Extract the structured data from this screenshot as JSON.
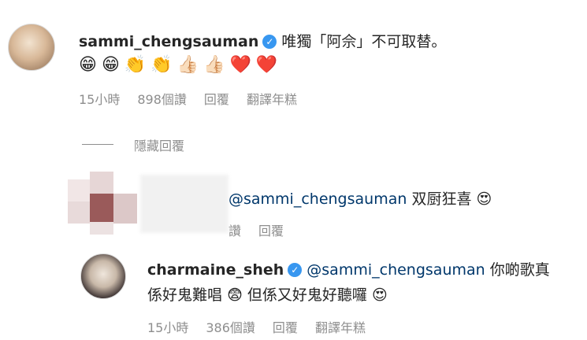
{
  "comments": [
    {
      "username": "sammi_chengsauman",
      "text": "唯獨「阿佘」不可取替。",
      "emojis": [
        "😁",
        "😁",
        "👏",
        "👏",
        "👍🏻",
        "👍🏻",
        "❤️",
        "❤️"
      ],
      "time": "15小時",
      "views": "898個讚",
      "reply": "回覆",
      "translate": "翻譯年糕"
    }
  ],
  "hide_replies": "隱藏回覆",
  "reply1": {
    "mention": "@sammi_chengsauman",
    "text": " 双厨狂喜",
    "emoji": "😍",
    "views_partial": "讚",
    "reply": "回覆"
  },
  "reply2": {
    "username": "charmaine_sheh",
    "mention": "@sammi_chengsauman",
    "text_line1": " 你啲歌真",
    "text_line2a": "係好鬼難唱",
    "emoji1": "😨",
    "text_line2b": "但係又好鬼好聽囉",
    "emoji2": "😍",
    "time": "15小時",
    "views": "386個讚",
    "reply": "回覆",
    "translate": "翻譯年糕"
  },
  "icons": {
    "verified": "verified-badge-icon",
    "verified_color": "#3897f0",
    "mention_color": "#00376b",
    "meta_color": "#8e8e8e"
  }
}
